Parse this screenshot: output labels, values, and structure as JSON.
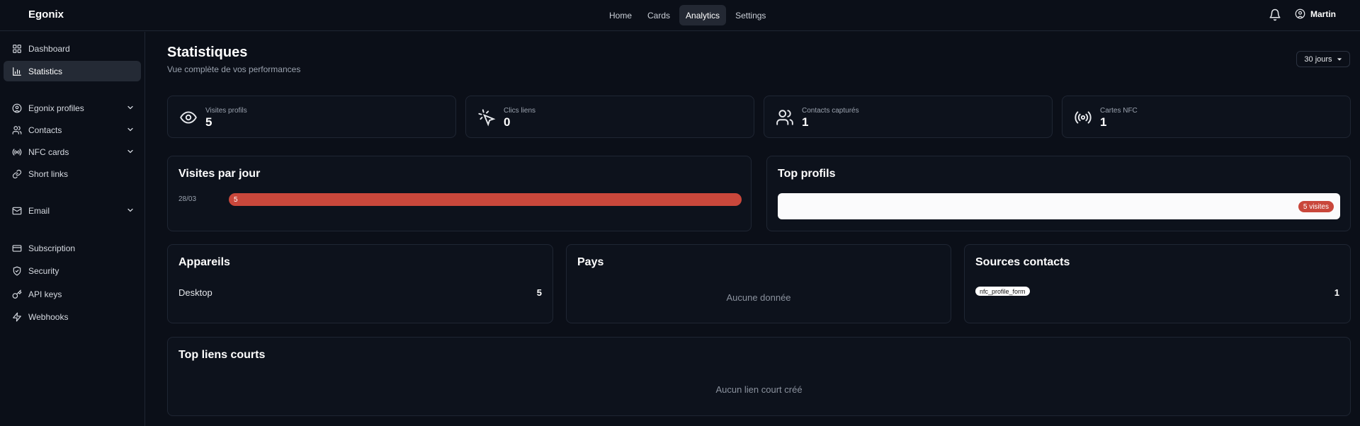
{
  "topbar": {
    "brand": "Egonix",
    "tabs": [
      {
        "label": "Home"
      },
      {
        "label": "Cards"
      },
      {
        "label": "Analytics",
        "active": true
      },
      {
        "label": "Settings"
      }
    ],
    "user_name": "Martin"
  },
  "sidebar": {
    "items": [
      {
        "label": "Dashboard",
        "icon": "grid-icon"
      },
      {
        "label": "Statistics",
        "icon": "bar-chart-icon",
        "active": true
      },
      {
        "label": "Egonix profiles",
        "icon": "user-circle-icon",
        "expandable": true
      },
      {
        "label": "Contacts",
        "icon": "users-icon",
        "expandable": true
      },
      {
        "label": "NFC cards",
        "icon": "nfc-icon",
        "expandable": true
      },
      {
        "label": "Short links",
        "icon": "link-icon"
      },
      {
        "label": "Email",
        "icon": "mail-icon",
        "expandable": true
      },
      {
        "label": "Subscription",
        "icon": "credit-card-icon"
      },
      {
        "label": "Security",
        "icon": "shield-icon"
      },
      {
        "label": "API keys",
        "icon": "key-icon"
      },
      {
        "label": "Webhooks",
        "icon": "zap-icon"
      }
    ]
  },
  "page": {
    "title": "Statistiques",
    "subtitle": "Vue complète de vos performances",
    "period": "30 jours"
  },
  "stats": [
    {
      "label": "Visites profils",
      "value": "5",
      "icon": "eye-icon"
    },
    {
      "label": "Clics liens",
      "value": "0",
      "icon": "pointer-click-icon"
    },
    {
      "label": "Contacts capturés",
      "value": "1",
      "icon": "users-icon"
    },
    {
      "label": "Cartes NFC",
      "value": "1",
      "icon": "nfc-signal-icon"
    }
  ],
  "visits_per_day": {
    "title": "Visites par jour",
    "rows": [
      {
        "date": "28/03",
        "value": "5",
        "fraction": 1.0
      }
    ]
  },
  "top_profiles": {
    "title": "Top profils",
    "rows": [
      {
        "name": "",
        "visits": "5 visites"
      }
    ]
  },
  "devices": {
    "title": "Appareils",
    "rows": [
      {
        "label": "Desktop",
        "value": "5"
      }
    ]
  },
  "countries": {
    "title": "Pays",
    "empty": "Aucune donnée"
  },
  "contact_sources": {
    "title": "Sources contacts",
    "rows": [
      {
        "label": "nfc_profile_form",
        "value": "1"
      }
    ]
  },
  "top_short_links": {
    "title": "Top liens courts",
    "empty": "Aucun lien court créé"
  },
  "colors": {
    "background": "#0b0f18",
    "card": "#0d121c",
    "accent_red": "#c9473b"
  }
}
